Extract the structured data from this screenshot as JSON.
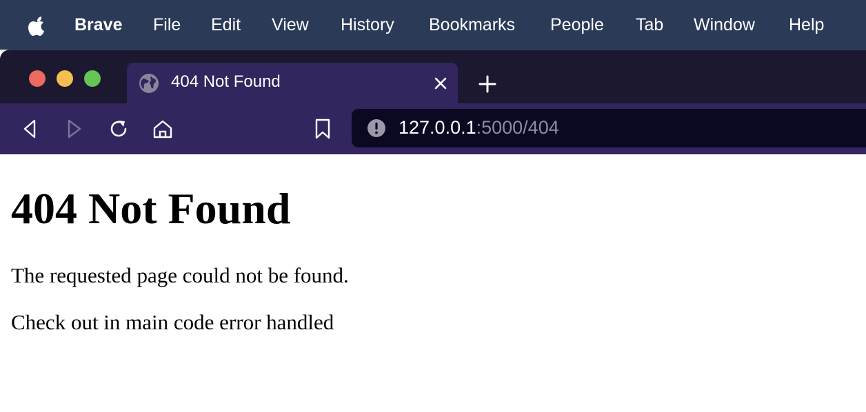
{
  "menubar": {
    "app_name": "Brave",
    "items": [
      "File",
      "Edit",
      "View",
      "History",
      "Bookmarks",
      "People",
      "Tab",
      "Window",
      "Help"
    ]
  },
  "tab": {
    "title": "404 Not Found"
  },
  "address": {
    "host": "127.0.0.1",
    "path": ":5000/404"
  },
  "page": {
    "heading": "404 Not Found",
    "paragraphs": [
      "The requested page could not be found.",
      "Check out in main code error handled"
    ]
  },
  "colors": {
    "menubar_bg": "#2a3a57",
    "tabstrip_bg": "#1b1830",
    "active_tab_bg": "#33255e",
    "urlbar_bg": "#0b0822"
  },
  "icons": {
    "apple": "apple-logo-icon",
    "tab_favicon": "globe-icon",
    "tab_close": "close-icon",
    "new_tab": "plus-icon",
    "back": "back-arrow-icon",
    "forward": "forward-arrow-icon",
    "reload": "reload-icon",
    "home": "home-icon",
    "bookmark": "bookmark-icon",
    "site_info": "info-warning-icon"
  }
}
